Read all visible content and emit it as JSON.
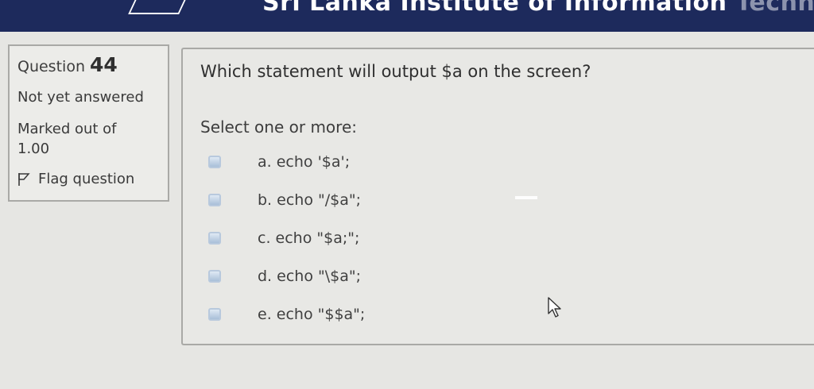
{
  "header": {
    "title_visible": "Sri Lanka Institute of Information",
    "title_tail": "Technology"
  },
  "question_info": {
    "label": "Question",
    "number": "44",
    "state": "Not yet answered",
    "grade_line1": "Marked out of",
    "grade_line2": "1.00",
    "flag_label": "Flag question"
  },
  "question": {
    "text": "Which statement will output $a on the screen?",
    "prompt": "Select one or more:",
    "options": [
      {
        "label": "a. echo '$a';",
        "checked": false
      },
      {
        "label": "b. echo \"/$a\";",
        "checked": false
      },
      {
        "label": "c. echo \"$a;\";",
        "checked": false
      },
      {
        "label": "d. echo \"\\$a\";",
        "checked": false
      },
      {
        "label": "e. echo \"$$a\";",
        "checked": false
      }
    ]
  },
  "colors": {
    "header_bg": "#1d2a5c",
    "checkbox_fill": "#a9bfd8"
  },
  "icons": {
    "flag": "flag-icon",
    "logo": "logo-icon",
    "cursor": "mouse-cursor-icon"
  }
}
